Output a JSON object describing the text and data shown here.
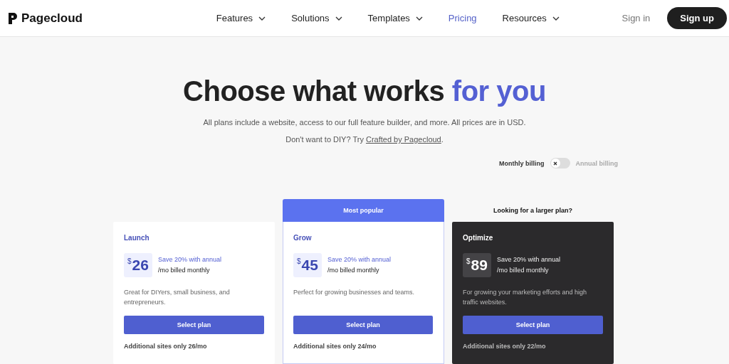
{
  "brand": {
    "name": "Pagecloud"
  },
  "nav": [
    {
      "label": "Features",
      "dropdown": true,
      "selected": false
    },
    {
      "label": "Solutions",
      "dropdown": true,
      "selected": false
    },
    {
      "label": "Templates",
      "dropdown": true,
      "selected": false
    },
    {
      "label": "Pricing",
      "dropdown": false,
      "selected": true
    },
    {
      "label": "Resources",
      "dropdown": true,
      "selected": false
    }
  ],
  "sign_in": "Sign in",
  "sign_up": "Sign up",
  "hero": {
    "title": "Choose what works",
    "title_accent": "for you",
    "subtitle": "All plans include a website, access to our full feature builder, and more. All prices are in USD.",
    "diy_text": "Don't want to DIY? Try",
    "diy_link": "Crafted by Pagecloud",
    "diy_end": "."
  },
  "billing": {
    "monthly_label": "Monthly billing",
    "annual_label": "Annual billing",
    "on": false
  },
  "plans": [
    {
      "name": "Launch",
      "kind": "light",
      "currency": "$",
      "price": "26",
      "save": "Save 20% with annual",
      "period": "/mo billed monthly",
      "description": "Great for DIYers, small business, and entrepreneurs.",
      "button": "Select plan",
      "extra": "Additional sites only 26/mo"
    },
    {
      "name": "Grow",
      "kind": "light",
      "top_note": {
        "kind": "banner",
        "text": "Most popular"
      },
      "currency": "$",
      "price": "45",
      "save": "Save 20% with annual",
      "period": "/mo billed monthly",
      "description": "Perfect for growing businesses and teams.",
      "button": "Select plan",
      "extra": "Additional sites only 24/mo"
    },
    {
      "name": "Optimize",
      "kind": "dark",
      "top_note": {
        "kind": "caption",
        "text": "Looking for a larger plan?"
      },
      "currency": "$",
      "price": "89",
      "save": "Save 20% with annual",
      "period": "/mo billed monthly",
      "description": "For growing your marketing efforts and high traffic websites.",
      "button": "Select plan",
      "extra": "Additional sites only 22/mo"
    }
  ]
}
